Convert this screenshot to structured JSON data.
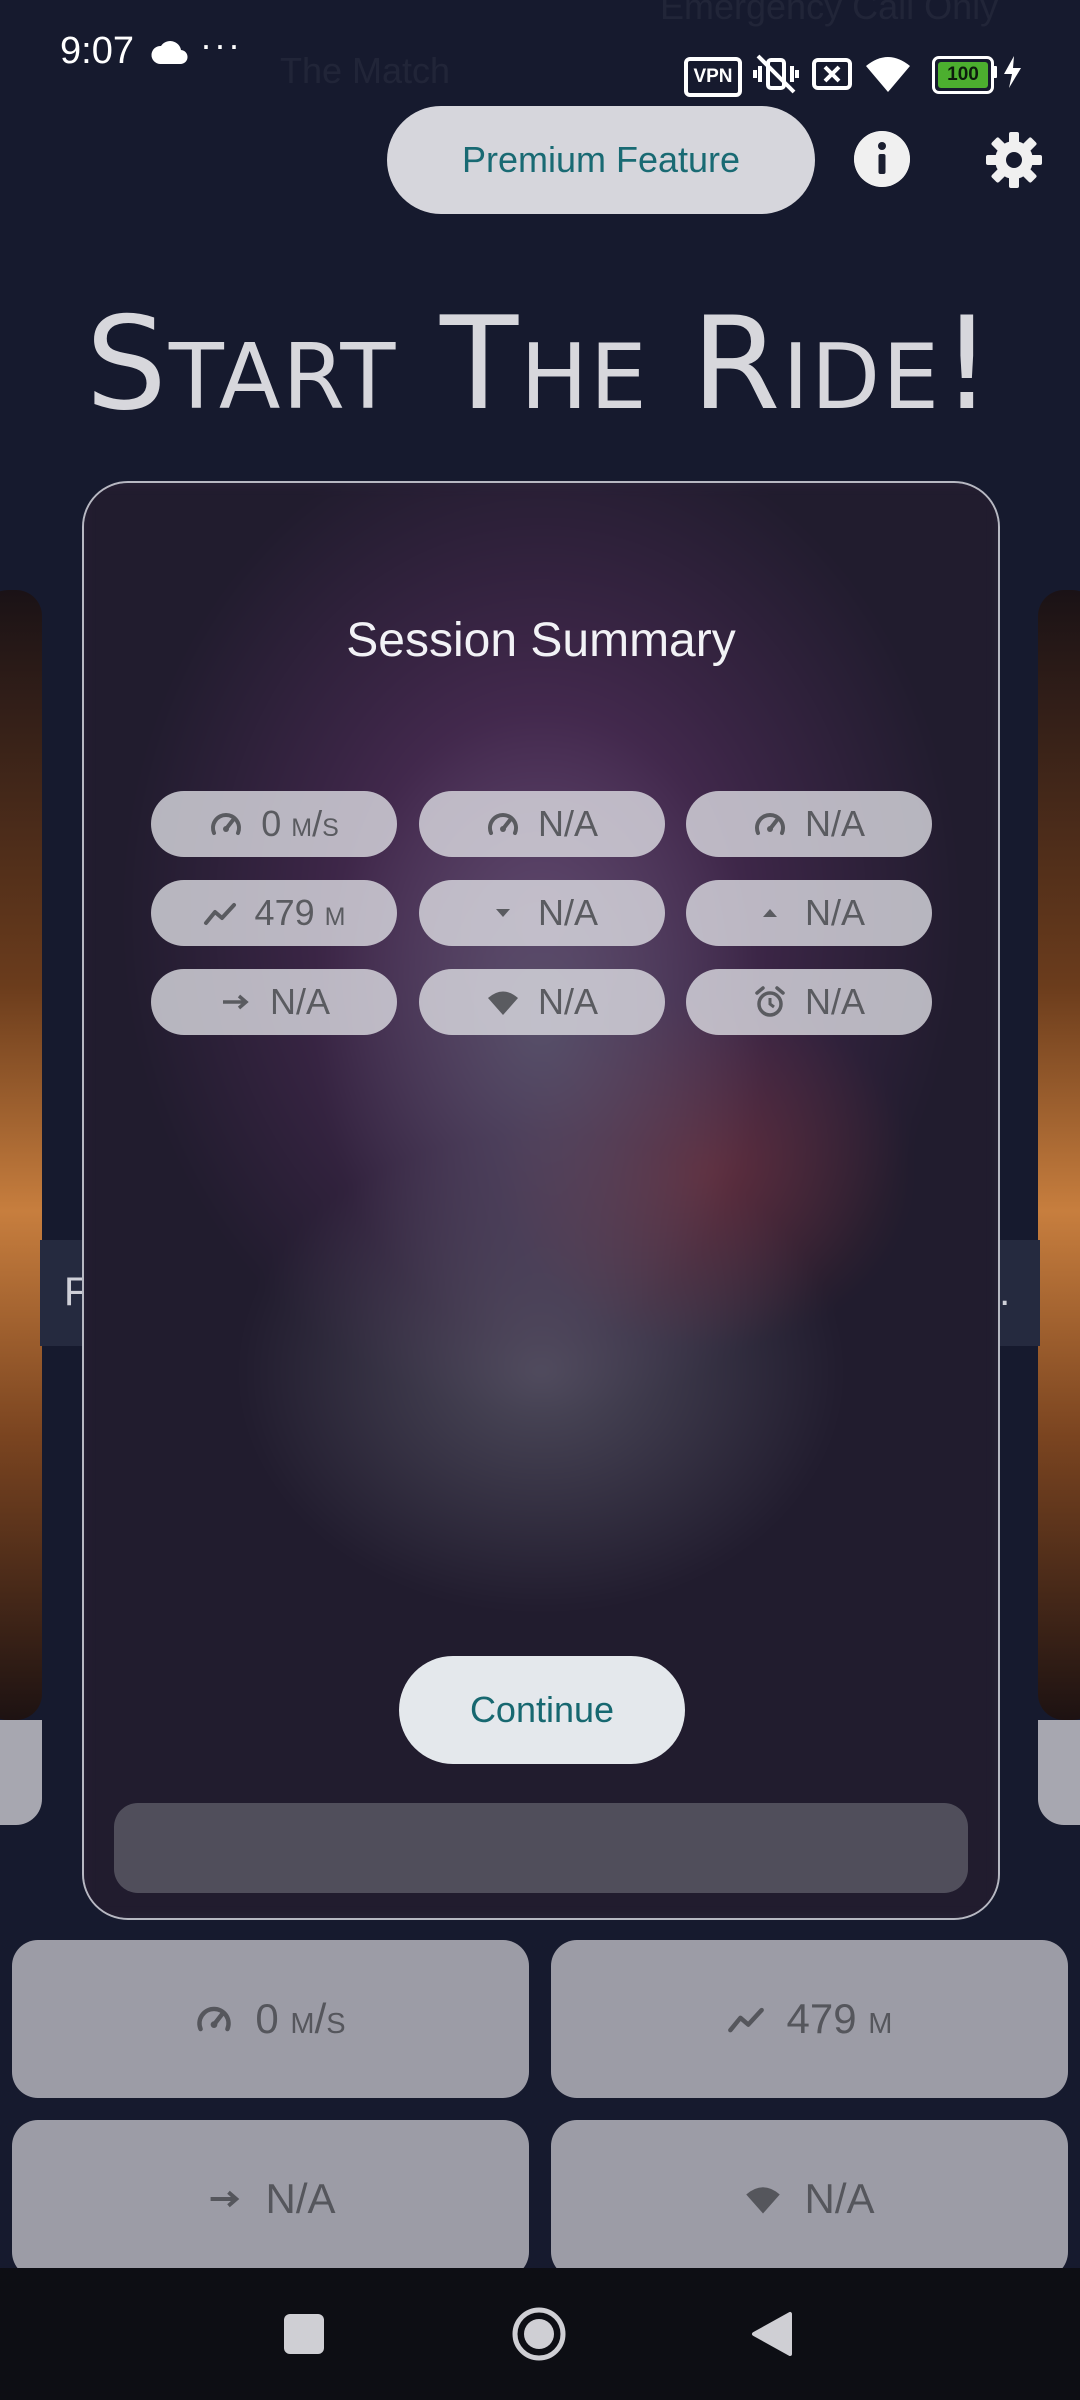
{
  "status_bar": {
    "time": "9:07",
    "overflow": "···",
    "vpn": "VPN",
    "battery": "100"
  },
  "background_text": {
    "top_right": "Emergency Call Only",
    "top_center": "The Match",
    "band_left": "F",
    "band_right": "t."
  },
  "header": {
    "premium_label": "Premium Feature",
    "title": "Start The Ride!"
  },
  "dialog": {
    "title": "Session Summary",
    "chips": [
      {
        "icon": "speedometer-icon",
        "text": "0 m/s"
      },
      {
        "icon": "speedometer-icon",
        "text": "N/A"
      },
      {
        "icon": "speedometer-icon",
        "text": "N/A"
      },
      {
        "icon": "trend-icon",
        "text": "479 m"
      },
      {
        "icon": "arrow-down-icon",
        "text": "N/A"
      },
      {
        "icon": "arrow-up-icon",
        "text": "N/A"
      },
      {
        "icon": "arrow-right-icon",
        "text": "N/A"
      },
      {
        "icon": "wifi-icon",
        "text": "N/A"
      },
      {
        "icon": "alarm-icon",
        "text": "N/A"
      }
    ],
    "continue_label": "Continue"
  },
  "stats": [
    {
      "icon": "speedometer-icon",
      "text": "0 m/s"
    },
    {
      "icon": "trend-icon",
      "text": "479 m"
    },
    {
      "icon": "arrow-right-icon",
      "text": "N/A"
    },
    {
      "icon": "wifi-icon",
      "text": "N/A"
    }
  ],
  "colors": {
    "background": "#161a2e",
    "accent_text": "#196a73",
    "chip_bg": "#dcdce2",
    "stat_card_bg": "#9c9ca6"
  }
}
